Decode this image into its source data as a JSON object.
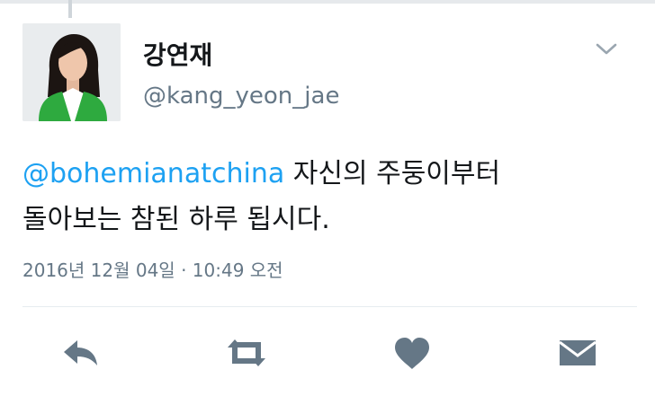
{
  "profile": {
    "display_name": "강연재",
    "handle": "@kang_yeon_jae",
    "avatar_bg": "#e9ecee",
    "jacket_color": "#2eaa3f"
  },
  "tweet": {
    "mention": "@bohemianatchina",
    "line1_rest": " 자신의 주둥이부터",
    "line2": "돌아보는 참된 하루 됩시다.",
    "timestamp": "2016년 12월 04일 · 10:49 오전"
  },
  "actions": [
    {
      "name": "reply",
      "icon": "reply-arrow-icon"
    },
    {
      "name": "retweet",
      "icon": "retweet-icon"
    },
    {
      "name": "like",
      "icon": "heart-icon"
    },
    {
      "name": "direct-message",
      "icon": "envelope-icon"
    }
  ],
  "colors": {
    "text": "#14171a",
    "secondary": "#657786",
    "link": "#1da1f2",
    "icon": "#657786"
  }
}
